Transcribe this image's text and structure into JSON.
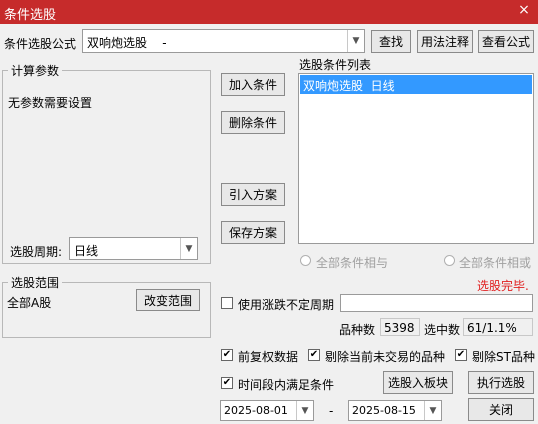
{
  "window": {
    "title": "条件选股",
    "close_glyph": "×"
  },
  "formula": {
    "label": "条件选股公式",
    "value": "双响炮选股    -",
    "find_button": "查找",
    "usage_button": "用法注释",
    "view_button": "查看公式"
  },
  "params": {
    "group_title": "计算参数",
    "none_text": "无参数需要设置",
    "period_label": "选股周期:",
    "period_value": "日线"
  },
  "condition_buttons": {
    "add": "加入条件",
    "delete": "删除条件",
    "import": "引入方案",
    "save": "保存方案"
  },
  "condition_list": {
    "title": "选股条件列表",
    "items": [
      "双响炮选股  日线"
    ]
  },
  "logic": {
    "and_label": "全部条件相与",
    "or_label": "全部条件相或"
  },
  "status": {
    "text": "选股完毕.",
    "color": "#e02020"
  },
  "range": {
    "group_title": "选股范围",
    "value": "全部A股",
    "change_button": "改变范围"
  },
  "volatility": {
    "label": "使用涨跌不定周期",
    "value": ""
  },
  "stats": {
    "count_label": "品种数",
    "count_value": "5398",
    "selected_label": "选中数",
    "selected_value": "61/1.1%"
  },
  "options": {
    "adjusted": "前复权数据",
    "exclude_untraded": "剔除当前未交易的品种",
    "exclude_st": "剔除ST品种",
    "period_satisfy": "时间段内满足条件"
  },
  "dates": {
    "start": "2025-08-01",
    "separator": "-",
    "end": "2025-08-15"
  },
  "actions": {
    "to_block": "选股入板块",
    "execute": "执行选股",
    "close": "关闭"
  },
  "colors": {
    "titlebar": "#c62b2b",
    "selection": "#3399ff"
  }
}
